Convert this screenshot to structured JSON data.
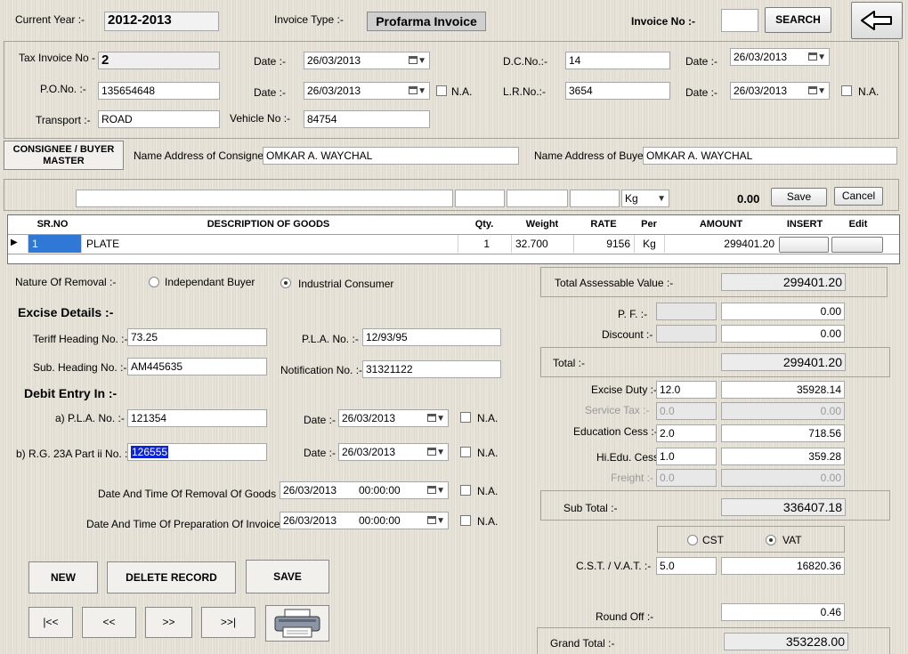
{
  "header": {
    "current_year_label": "Current Year :-",
    "current_year": "2012-2013",
    "invoice_type_label": "Invoice Type :-",
    "invoice_type": "Profarma Invoice",
    "invoice_no_label": "Invoice No :-",
    "invoice_no": "",
    "search_label": "SEARCH",
    "back_icon": "arrow-left-icon"
  },
  "invoice_info": {
    "tax_invoice_label": "Tax Invoice No -",
    "tax_invoice_no": "2",
    "date_label": "Date :-",
    "tax_date": "26/03/2013",
    "dc_label": "D.C.No.:-",
    "dc_no": "14",
    "dc_date": "26/03/2013",
    "po_label": "P.O.No. :-",
    "po_no": "135654648",
    "po_date": "26/03/2013",
    "na_label": "N.A.",
    "lr_label": "L.R.No.:-",
    "lr_no": "3654",
    "lr_date": "26/03/2013",
    "transport_label": "Transport :-",
    "transport": "ROAD",
    "vehicle_label": "Vehicle No :-",
    "vehicle_no": "84754"
  },
  "consignee": {
    "master_button": "CONSIGNEE / BUYER MASTER",
    "consignee_label": "Name Address of Consignee :-",
    "consignee_value": "OMKAR A. WAYCHAL",
    "buyer_label": "Name Address of Buyer :-",
    "buyer_value": "OMKAR A. WAYCHAL"
  },
  "entry_bar": {
    "unit_selected": "Kg",
    "amount": "0.00",
    "save_label": "Save",
    "cancel_label": "Cancel"
  },
  "goods_table": {
    "columns": [
      "SR.NO",
      "DESCRIPTION OF GOODS",
      "Qty.",
      "Weight",
      "RATE",
      "Per",
      "AMOUNT",
      "INSERT",
      "Edit"
    ],
    "rows": [
      {
        "sr": "1",
        "description": "PLATE",
        "qty": "1",
        "weight": "32.700",
        "rate": "9156",
        "per": "Kg",
        "amount": "299401.20"
      }
    ]
  },
  "removal": {
    "label": "Nature Of Removal :-",
    "option1": "Independant Buyer",
    "option2": "Industrial Consumer",
    "selected": "Industrial Consumer"
  },
  "excise": {
    "title": "Excise Details :-",
    "tariff_label": "Teriff Heading No. :-",
    "tariff": "73.25",
    "pla_label": "P.L.A. No. :-",
    "pla": "12/93/95",
    "sub_heading_label": "Sub. Heading No. :-",
    "sub_heading": "AM445635",
    "notification_label": "Notification No. :-",
    "notification": "31321122"
  },
  "debit": {
    "title": "Debit Entry In :-",
    "pla_label": "a) P.L.A. No. :-",
    "pla_no": "121354",
    "date_label": "Date :-",
    "pla_date": "26/03/2013",
    "rg_label": "b) R.G. 23A Part ii No. :-",
    "rg_no": "126555",
    "rg_date": "26/03/2013",
    "na_label": "N.A.",
    "removal_time_label": "Date And Time Of Removal Of Goods :-",
    "removal_date": "26/03/2013",
    "removal_time": "00:00:00",
    "prep_time_label": "Date And Time Of Preparation Of Invoice :-",
    "prep_date": "26/03/2013",
    "prep_time": "00:00:00"
  },
  "actions": {
    "new": "NEW",
    "delete": "DELETE RECORD",
    "save": "SAVE",
    "first": "|<<",
    "prev": "<<",
    "next": ">>",
    "last": ">>|",
    "print_icon": "printer-icon"
  },
  "totals": {
    "assessable_label": "Total Assessable Value :-",
    "assessable": "299401.20",
    "pf_label": "P. F. :-",
    "pf_pct": "",
    "pf": "0.00",
    "discount_label": "Discount :-",
    "discount_pct": "",
    "discount": "0.00",
    "total_label": "Total :-",
    "total": "299401.20",
    "excise_label": "Excise Duty :-",
    "excise_pct": "12.0",
    "excise": "35928.14",
    "service_label": "Service Tax :-",
    "service_pct": "0.0",
    "service": "0.00",
    "edu_label": "Education Cess :-",
    "edu_pct": "2.0",
    "edu": "718.56",
    "hiedu_label": "Hi.Edu. Cess :-",
    "hiedu_pct": "1.0",
    "hiedu": "359.28",
    "freight_label": "Freight :-",
    "freight_pct": "0.0",
    "freight": "0.00",
    "subtotal_label": "Sub Total :-",
    "subtotal": "336407.18",
    "cst_option": "CST",
    "vat_option": "VAT",
    "tax_selected": "VAT",
    "cstvat_label": "C.S.T. / V.A.T. :-",
    "cstvat_pct": "5.0",
    "cstvat": "16820.36",
    "roundoff_label": "Round Off :-",
    "roundoff": "0.46",
    "grand_label": "Grand Total :-",
    "grand": "353228.00"
  }
}
